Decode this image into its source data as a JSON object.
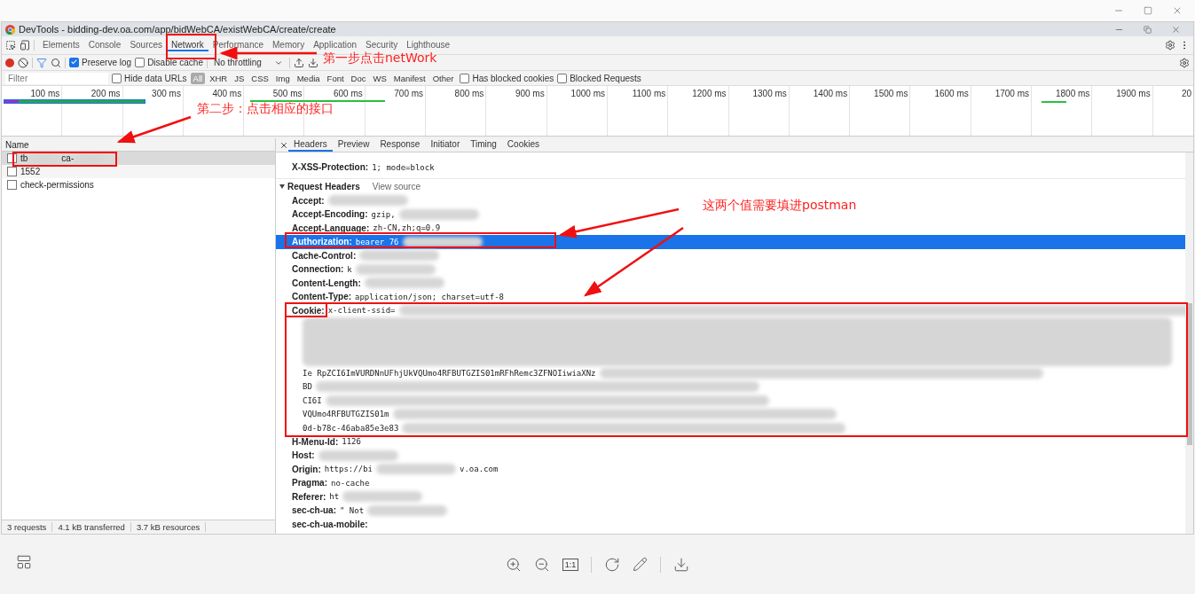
{
  "devtools_window": {
    "title": "DevTools - bidding-dev.oa.com/app/bidWebCA/existWebCA/create/create"
  },
  "panel_tabs": [
    {
      "label": "Elements",
      "selected": false
    },
    {
      "label": "Console",
      "selected": false
    },
    {
      "label": "Sources",
      "selected": false
    },
    {
      "label": "Network",
      "selected": true
    },
    {
      "label": "Performance",
      "selected": false
    },
    {
      "label": "Memory",
      "selected": false
    },
    {
      "label": "Application",
      "selected": false
    },
    {
      "label": "Security",
      "selected": false
    },
    {
      "label": "Lighthouse",
      "selected": false
    }
  ],
  "toolbar": {
    "recording": true,
    "checkboxes": [
      {
        "label": "Preserve log",
        "checked": true
      },
      {
        "label": "Disable cache",
        "checked": false
      }
    ],
    "throttling": "No throttling"
  },
  "filter_bar": {
    "placeholder": "Filter",
    "hide_data_urls": {
      "label": "Hide data URLs",
      "checked": false
    },
    "types": [
      {
        "label": "All",
        "selected": true
      },
      {
        "label": "XHR",
        "selected": false
      },
      {
        "label": "JS",
        "selected": false
      },
      {
        "label": "CSS",
        "selected": false
      },
      {
        "label": "Img",
        "selected": false
      },
      {
        "label": "Media",
        "selected": false
      },
      {
        "label": "Font",
        "selected": false
      },
      {
        "label": "Doc",
        "selected": false
      },
      {
        "label": "WS",
        "selected": false
      },
      {
        "label": "Manifest",
        "selected": false
      },
      {
        "label": "Other",
        "selected": false
      }
    ],
    "extra_checkboxes": [
      {
        "label": "Has blocked cookies",
        "checked": false
      },
      {
        "label": "Blocked Requests",
        "checked": false
      }
    ]
  },
  "overview": {
    "ticks": [
      "100 ms",
      "200 ms",
      "300 ms",
      "400 ms",
      "500 ms",
      "600 ms",
      "700 ms",
      "800 ms",
      "900 ms",
      "1000 ms",
      "1100 ms",
      "1200 ms",
      "1300 ms",
      "1400 ms",
      "1500 ms",
      "1600 ms",
      "1700 ms",
      "1800 ms",
      "1900 ms",
      "20"
    ]
  },
  "requests": {
    "column": "Name",
    "rows": [
      {
        "name": "tb",
        "name_end": "ca-",
        "redacted": true,
        "selected": true
      },
      {
        "name": "1552",
        "redacted": false,
        "selected": false
      },
      {
        "name": "check-permissions",
        "redacted": false,
        "selected": false
      }
    ]
  },
  "detail_tabs": [
    {
      "label": "Headers",
      "selected": true
    },
    {
      "label": "Preview",
      "selected": false
    },
    {
      "label": "Response",
      "selected": false
    },
    {
      "label": "Initiator",
      "selected": false
    },
    {
      "label": "Timing",
      "selected": false
    },
    {
      "label": "Cookies",
      "selected": false
    }
  ],
  "response_headers": [
    {
      "name": "X-XSS-Protection:",
      "value": "1; mode=block",
      "redacted": false,
      "selected": false
    }
  ],
  "request_headers_section": {
    "title": "Request Headers",
    "link": "View source",
    "expanded": true
  },
  "request_headers": [
    {
      "name": "Accept:",
      "redacted": true,
      "selected": false
    },
    {
      "name": "Accept-Encoding:",
      "value": "gzip,",
      "redacted": true,
      "selected": false
    },
    {
      "name": "Accept-Language:",
      "value": "zh-CN,zh;q=0.9",
      "redacted": false,
      "selected": false
    },
    {
      "name": "Authorization:",
      "value": "bearer 76",
      "redacted": true,
      "selected": true
    },
    {
      "name": "Cache-Control:",
      "redacted": true,
      "selected": false
    },
    {
      "name": "Connection:",
      "value": "k",
      "redacted": true,
      "selected": false
    },
    {
      "name": "Content-Length:",
      "redacted": true,
      "selected": false
    },
    {
      "name": "Content-Type:",
      "value": "application/json; charset=utf-8",
      "redacted": false,
      "selected": false
    },
    {
      "name": "Cookie:",
      "value": "x-client-ssid=",
      "redacted": true,
      "selected": false,
      "more_lines": [
        "Ie RpZCI6ImVURDNnUFhjUkVQUmo4RFBUTGZIS01mRFhRemc3ZFNOIiwiaXNz",
        "BD",
        "CI6I",
        "VQUmo4RFBUTGZIS01m",
        "0d-b78c-46aba85e3e83"
      ]
    },
    {
      "name": "H-Menu-Id:",
      "value": "1126",
      "redacted": false,
      "selected": false
    },
    {
      "name": "Host:",
      "redacted": true,
      "selected": false
    },
    {
      "name": "Origin:",
      "value": "https://bi",
      "redacted": true,
      "selected": false,
      "value_end": "v.oa.com"
    },
    {
      "name": "Pragma:",
      "value": "no-cache",
      "redacted": false,
      "selected": false
    },
    {
      "name": "Referer:",
      "value": "ht",
      "redacted": true,
      "selected": false
    },
    {
      "name": "sec-ch-ua:",
      "value": "\" Not",
      "redacted": true,
      "selected": false
    },
    {
      "name": "sec-ch-ua-mobile:",
      "redacted": false,
      "selected": false
    }
  ],
  "status_bar": [
    "3 requests",
    "4.1 kB transferred",
    "3.7 kB resources"
  ],
  "viewer_toolbar": {
    "actual_size": "1:1"
  },
  "annotations": [
    {
      "text": "第一步点击netWork"
    },
    {
      "text": "第二步：点击相应的接口"
    },
    {
      "text": "这两个值需要填进postman"
    }
  ]
}
